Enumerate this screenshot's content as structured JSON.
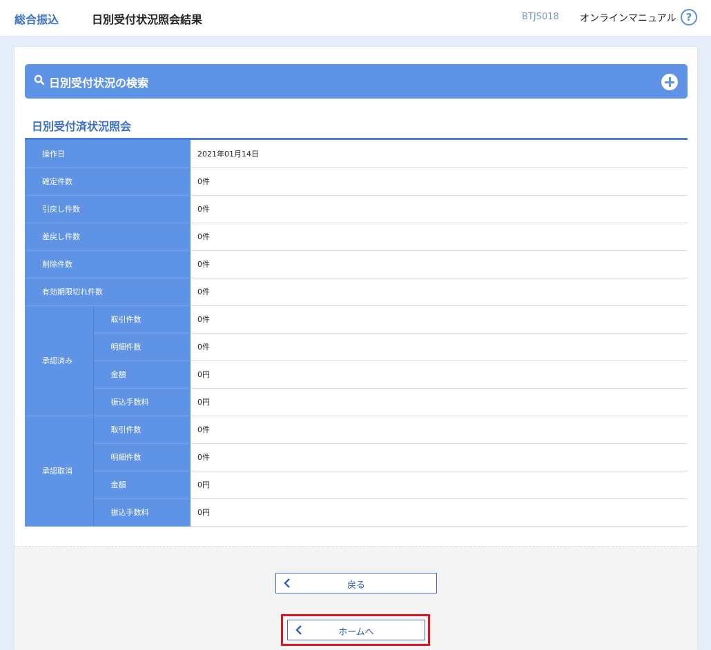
{
  "header": {
    "service": "総合振込",
    "title": "日別受付状況照会結果",
    "screen_code": "BTJS018",
    "manual_label": "オンラインマニュアル",
    "help_glyph": "?"
  },
  "search": {
    "label": "日別受付状況の検索"
  },
  "section": {
    "title": "日別受付済状況照会"
  },
  "rows": [
    {
      "label": "操作日",
      "value": "2021年01月14日"
    },
    {
      "label": "確定件数",
      "value": "0件"
    },
    {
      "label": "引戻し件数",
      "value": "0件"
    },
    {
      "label": "差戻し件数",
      "value": "0件"
    },
    {
      "label": "削除件数",
      "value": "0件"
    },
    {
      "label": "有効期限切れ件数",
      "value": "0件"
    }
  ],
  "groups": [
    {
      "label": "承認済み",
      "rows": [
        {
          "label": "取引件数",
          "value": "0件"
        },
        {
          "label": "明細件数",
          "value": "0件"
        },
        {
          "label": "金額",
          "value": "0円"
        },
        {
          "label": "振込手数料",
          "value": "0円"
        }
      ]
    },
    {
      "label": "承認取消",
      "rows": [
        {
          "label": "取引件数",
          "value": "0件"
        },
        {
          "label": "明細件数",
          "value": "0件"
        },
        {
          "label": "金額",
          "value": "0円"
        },
        {
          "label": "振込手数料",
          "value": "0円"
        }
      ]
    }
  ],
  "buttons": {
    "back": "戻る",
    "home": "ホームへ"
  },
  "colors": {
    "accent": "#5e93e6",
    "brand_text": "#3a6fc4",
    "highlight": "#e0141c"
  }
}
